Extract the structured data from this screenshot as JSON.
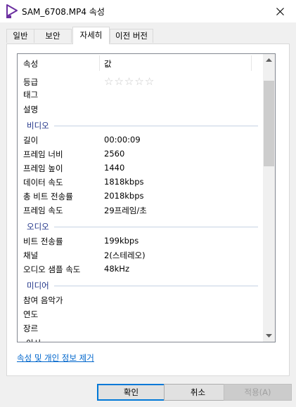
{
  "window": {
    "title": "SAM_6708.MP4 속성"
  },
  "tabs": [
    {
      "label": "일반"
    },
    {
      "label": "보안"
    },
    {
      "label": "자세히"
    },
    {
      "label": "이전 버전"
    }
  ],
  "table": {
    "col_name": "속성",
    "col_value": "값",
    "rating": {
      "stars_total": 5,
      "stars_filled": 0
    },
    "rows": {
      "rating": {
        "name": "등급"
      },
      "tags": {
        "name": "태그"
      },
      "comments": {
        "name": "설명"
      },
      "video_group": "비디오",
      "length": {
        "name": "길이",
        "value": "00:00:09"
      },
      "frame_width": {
        "name": "프레임 너비",
        "value": "2560"
      },
      "frame_height": {
        "name": "프레임 높이",
        "value": "1440"
      },
      "data_rate": {
        "name": "데이터 속도",
        "value": "1818kbps"
      },
      "total_bitrate": {
        "name": "총 비트 전송률",
        "value": "2018kbps"
      },
      "frame_rate": {
        "name": "프레임 속도",
        "value": "29프레임/초"
      },
      "audio_group": "오디오",
      "bitrate": {
        "name": "비트 전송률",
        "value": "199kbps"
      },
      "channels": {
        "name": "채널",
        "value": "2(스테레오)"
      },
      "sample_rate": {
        "name": "오디오 샘플 속도",
        "value": "48kHz"
      },
      "media_group": "미디어",
      "contributing_artists": {
        "name": "참여 음악가"
      },
      "year": {
        "name": "연도"
      },
      "genre": {
        "name": "장르"
      },
      "partial_next": {
        "name": "이시"
      }
    }
  },
  "remove_link": "속성 및 개인 정보 제거",
  "buttons": {
    "ok": "확인",
    "cancel": "취소",
    "apply": "적용(A)"
  },
  "colors": {
    "accent": "#0078d7",
    "group_header": "#1e3287",
    "link": "#0066cc"
  }
}
